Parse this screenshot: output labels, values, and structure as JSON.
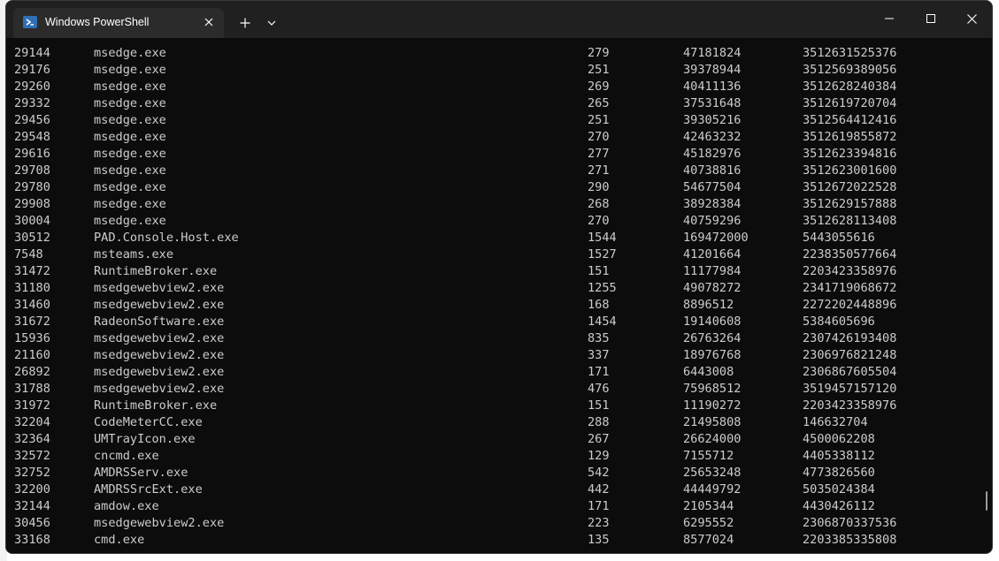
{
  "window": {
    "tab_title": "Windows PowerShell",
    "icons": {
      "tab": "powershell-icon",
      "close_tab": "close-icon",
      "new_tab": "plus-icon",
      "dropdown": "chevron-down-icon",
      "minimize": "minimize-icon",
      "maximize": "maximize-icon",
      "close_window": "close-icon"
    }
  },
  "colors": {
    "terminal_bg": "#0c0c0c",
    "terminal_fg": "#cccccc",
    "titlebar_bg": "#202020",
    "tab_bg": "#2b2b2b",
    "powershell_blue": "#2f6fb5"
  },
  "terminal": {
    "rows": [
      {
        "pid": "29144",
        "name": "msedge.exe",
        "handles": "279",
        "ws": "47181824",
        "vm": "3512631525376"
      },
      {
        "pid": "29176",
        "name": "msedge.exe",
        "handles": "251",
        "ws": "39378944",
        "vm": "3512569389056"
      },
      {
        "pid": "29260",
        "name": "msedge.exe",
        "handles": "269",
        "ws": "40411136",
        "vm": "3512628240384"
      },
      {
        "pid": "29332",
        "name": "msedge.exe",
        "handles": "265",
        "ws": "37531648",
        "vm": "3512619720704"
      },
      {
        "pid": "29456",
        "name": "msedge.exe",
        "handles": "251",
        "ws": "39305216",
        "vm": "3512564412416"
      },
      {
        "pid": "29548",
        "name": "msedge.exe",
        "handles": "270",
        "ws": "42463232",
        "vm": "3512619855872"
      },
      {
        "pid": "29616",
        "name": "msedge.exe",
        "handles": "277",
        "ws": "45182976",
        "vm": "3512623394816"
      },
      {
        "pid": "29708",
        "name": "msedge.exe",
        "handles": "271",
        "ws": "40738816",
        "vm": "3512623001600"
      },
      {
        "pid": "29780",
        "name": "msedge.exe",
        "handles": "290",
        "ws": "54677504",
        "vm": "3512672022528"
      },
      {
        "pid": "29908",
        "name": "msedge.exe",
        "handles": "268",
        "ws": "38928384",
        "vm": "3512629157888"
      },
      {
        "pid": "30004",
        "name": "msedge.exe",
        "handles": "270",
        "ws": "40759296",
        "vm": "3512628113408"
      },
      {
        "pid": "30512",
        "name": "PAD.Console.Host.exe",
        "handles": "1544",
        "ws": "169472000",
        "vm": "5443055616"
      },
      {
        "pid": "7548",
        "name": "msteams.exe",
        "handles": "1527",
        "ws": "41201664",
        "vm": "2238350577664"
      },
      {
        "pid": "31472",
        "name": "RuntimeBroker.exe",
        "handles": "151",
        "ws": "11177984",
        "vm": "2203423358976"
      },
      {
        "pid": "31180",
        "name": "msedgewebview2.exe",
        "handles": "1255",
        "ws": "49078272",
        "vm": "2341719068672"
      },
      {
        "pid": "31460",
        "name": "msedgewebview2.exe",
        "handles": "168",
        "ws": "8896512",
        "vm": "2272202448896"
      },
      {
        "pid": "31672",
        "name": "RadeonSoftware.exe",
        "handles": "1454",
        "ws": "19140608",
        "vm": "5384605696"
      },
      {
        "pid": "15936",
        "name": "msedgewebview2.exe",
        "handles": "835",
        "ws": "26763264",
        "vm": "2307426193408"
      },
      {
        "pid": "21160",
        "name": "msedgewebview2.exe",
        "handles": "337",
        "ws": "18976768",
        "vm": "2306976821248"
      },
      {
        "pid": "26892",
        "name": "msedgewebview2.exe",
        "handles": "171",
        "ws": "6443008",
        "vm": "2306867605504"
      },
      {
        "pid": "31788",
        "name": "msedgewebview2.exe",
        "handles": "476",
        "ws": "75968512",
        "vm": "3519457157120"
      },
      {
        "pid": "31972",
        "name": "RuntimeBroker.exe",
        "handles": "151",
        "ws": "11190272",
        "vm": "2203423358976"
      },
      {
        "pid": "32204",
        "name": "CodeMeterCC.exe",
        "handles": "288",
        "ws": "21495808",
        "vm": "146632704"
      },
      {
        "pid": "32364",
        "name": "UMTrayIcon.exe",
        "handles": "267",
        "ws": "26624000",
        "vm": "4500062208"
      },
      {
        "pid": "32572",
        "name": "cncmd.exe",
        "handles": "129",
        "ws": "7155712",
        "vm": "4405338112"
      },
      {
        "pid": "32752",
        "name": "AMDRSServ.exe",
        "handles": "542",
        "ws": "25653248",
        "vm": "4773826560"
      },
      {
        "pid": "32200",
        "name": "AMDRSSrcExt.exe",
        "handles": "442",
        "ws": "44449792",
        "vm": "5035024384"
      },
      {
        "pid": "32144",
        "name": "amdow.exe",
        "handles": "171",
        "ws": "2105344",
        "vm": "4430426112"
      },
      {
        "pid": "30456",
        "name": "msedgewebview2.exe",
        "handles": "223",
        "ws": "6295552",
        "vm": "2306870337536"
      },
      {
        "pid": "33168",
        "name": "cmd.exe",
        "handles": "135",
        "ws": "8577024",
        "vm": "2203385335808"
      }
    ]
  }
}
